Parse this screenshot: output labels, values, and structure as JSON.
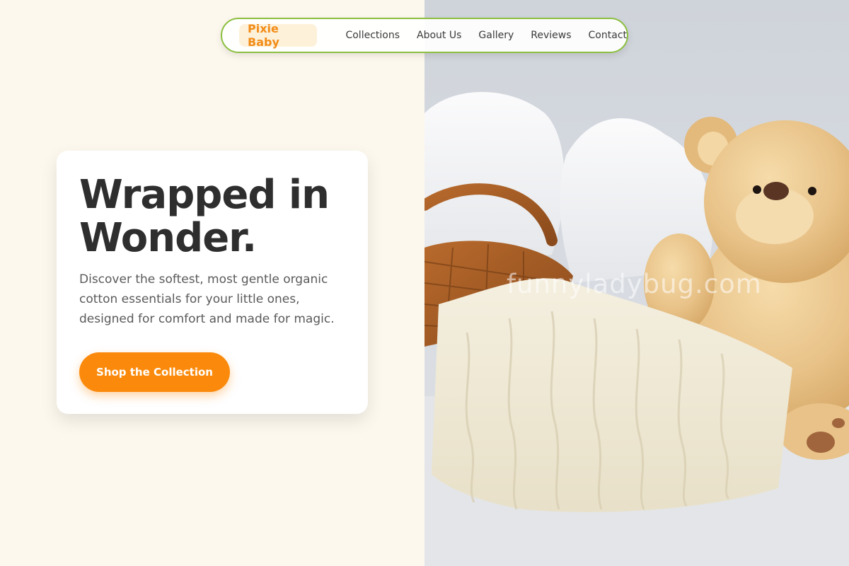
{
  "nav": {
    "brand": "Pixie Baby",
    "links": [
      "Collections",
      "About Us",
      "Gallery",
      "Reviews",
      "Contact"
    ]
  },
  "hero": {
    "title": "Wrapped in Wonder.",
    "description": "Discover the softest, most gentle organic cotton essentials for your little ones, designed for comfort and made for magic.",
    "cta_label": "Shop the Collection"
  },
  "image": {
    "watermark": "funnyladybug.com",
    "subject": "teddy-bear-basket-blanket-photo"
  },
  "colors": {
    "accent": "#fb8a0c",
    "brand_text": "#f28c18",
    "brand_bg": "#fdf1da",
    "nav_border": "#8cbf3f",
    "left_background": "#fdf8ee",
    "heading": "#2e2e2e",
    "body_text": "#5a5a5a"
  }
}
